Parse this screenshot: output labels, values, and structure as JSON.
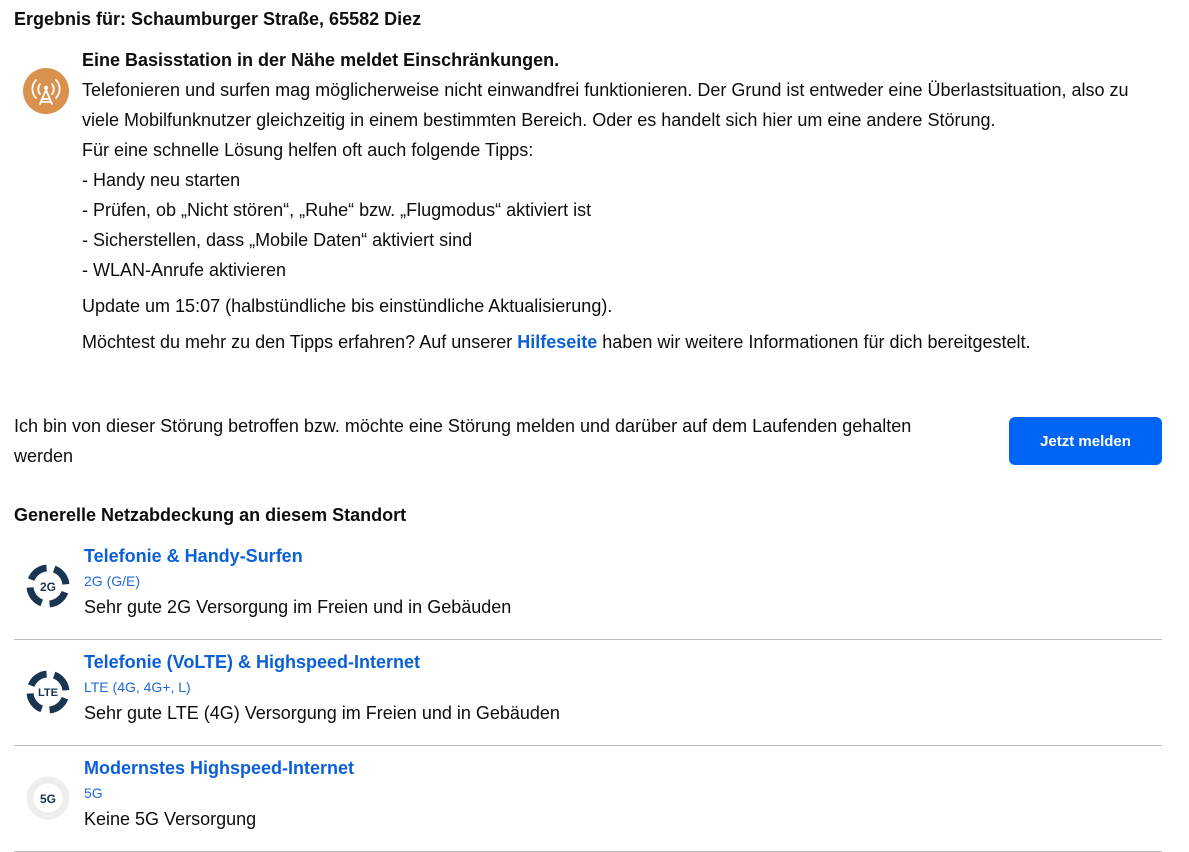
{
  "result": {
    "title": "Ergebnis für: Schaumburger Straße, 65582 Diez"
  },
  "alert": {
    "icon": "cell-tower-icon",
    "icon_color": "#d9924e",
    "heading": "Eine Basisstation in der Nähe meldet Einschränkungen.",
    "description": "Telefonieren und surfen mag möglicherweise nicht einwandfrei funktionieren. Der Grund ist entweder eine Überlastsituation, also zu viele Mobilfunknutzer gleichzeitig in einem bestimmten Bereich. Oder es handelt sich hier um eine andere Störung.",
    "tips_intro": "Für eine schnelle Lösung helfen oft auch folgende Tipps:",
    "tips": [
      "- Handy neu starten",
      "- Prüfen, ob „Nicht stören“, „Ruhe“ bzw. „Flugmodus“ aktiviert ist",
      "- Sicherstellen, dass „Mobile Daten“ aktiviert sind",
      "- WLAN-Anrufe aktivieren"
    ],
    "update": "Update um 15:07 (halbstündliche bis einstündliche Aktualisierung).",
    "help_prefix": "Möchtest du mehr zu den Tipps erfahren? Auf unserer ",
    "help_link": "Hilfeseite",
    "help_suffix": " haben wir weitere Informationen für dich bereitgestelt."
  },
  "report": {
    "text": "Ich bin von dieser Störung betroffen bzw. möchte eine Störung melden und darüber auf dem Laufenden gehalten werden",
    "button_label": "Jetzt melden",
    "button_color": "#0064f5"
  },
  "coverage": {
    "title": "Generelle Netzabdeckung an diesem Standort",
    "items": [
      {
        "icon": "2g-icon",
        "badge": "2G",
        "name": "Telefonie & Handy-Surfen",
        "tech": "2G (G/E)",
        "description": "Sehr gute 2G Versorgung im Freien und in Gebäuden"
      },
      {
        "icon": "lte-icon",
        "badge": "LTE",
        "name": "Telefonie (VoLTE) & Highspeed-Internet",
        "tech": "LTE (4G, 4G+, L)",
        "description": "Sehr gute LTE (4G) Versorgung im Freien und in Gebäuden"
      },
      {
        "icon": "5g-icon",
        "badge": "5G",
        "name": "Modernstes Highspeed-Internet",
        "tech": "5G",
        "description": "Keine 5G Versorgung"
      }
    ]
  }
}
